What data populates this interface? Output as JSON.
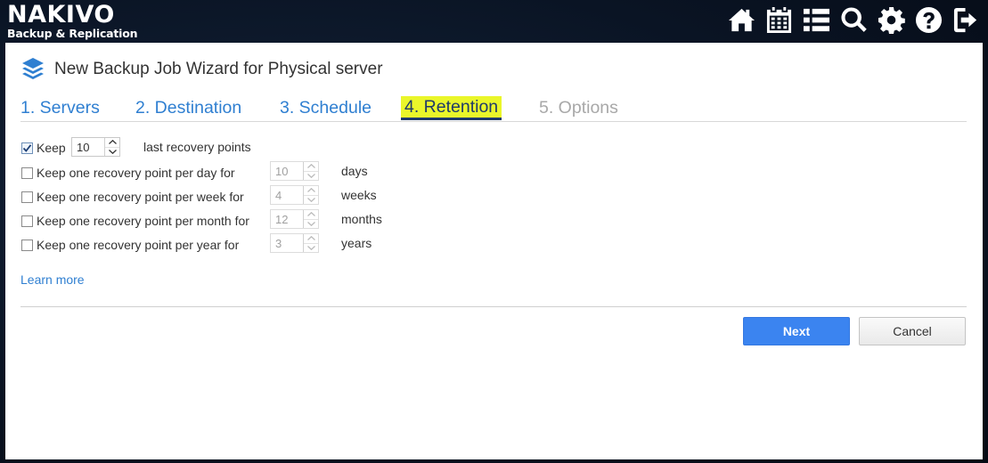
{
  "brand": {
    "name": "NAKIVO",
    "tagline": "Backup & Replication"
  },
  "top_icons": [
    "home-icon",
    "calendar-icon",
    "list-icon",
    "search-icon",
    "gear-icon",
    "help-icon",
    "logout-icon"
  ],
  "wizard": {
    "title": "New Backup Job Wizard for Physical server"
  },
  "steps": [
    {
      "label": "1. Servers",
      "state": "done"
    },
    {
      "label": "2. Destination",
      "state": "done"
    },
    {
      "label": "3. Schedule",
      "state": "done"
    },
    {
      "label": "4. Retention",
      "state": "active"
    },
    {
      "label": "5. Options",
      "state": "disabled"
    }
  ],
  "retention": {
    "keep": {
      "checked": true,
      "label": "Keep",
      "value": "10",
      "suffix": "last recovery points"
    },
    "rows": [
      {
        "label": "Keep one recovery point per day for",
        "value": "10",
        "unit": "days",
        "checked": false
      },
      {
        "label": "Keep one recovery point per week for",
        "value": "4",
        "unit": "weeks",
        "checked": false
      },
      {
        "label": "Keep one recovery point per month for",
        "value": "12",
        "unit": "months",
        "checked": false
      },
      {
        "label": "Keep one recovery point per year for",
        "value": "3",
        "unit": "years",
        "checked": false
      }
    ]
  },
  "learn_more": "Learn more",
  "buttons": {
    "next": "Next",
    "cancel": "Cancel"
  },
  "colors": {
    "link": "#2f7fd1",
    "active_step_highlight": "#eaf62a",
    "primary_button": "#3b84f0",
    "disabled_text": "#a8a8a8"
  }
}
